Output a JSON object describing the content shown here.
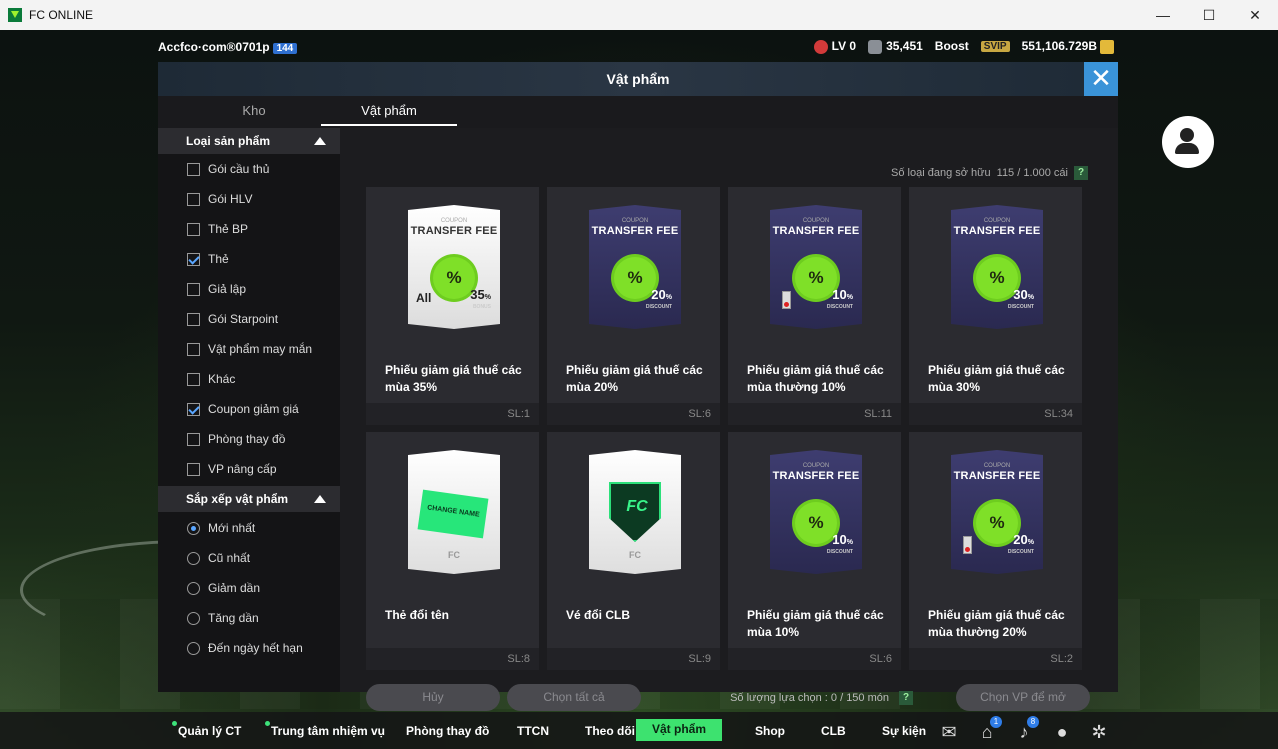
{
  "window": {
    "title": "FC ONLINE",
    "minimize": "—",
    "maximize": "☐",
    "close": "✕"
  },
  "topbar": {
    "account": "Accfco·com®0701p",
    "account_number": "144",
    "level": "LV 0",
    "trophies": "35,451",
    "boost": "Boost",
    "svip": "SVIP",
    "bp": "551,106.729B"
  },
  "dialog": {
    "title": "Vật phẩm",
    "close": "✕",
    "tabs": [
      {
        "label": "Kho"
      },
      {
        "label": "Vật phẩm"
      }
    ],
    "owned_label": "Số loại đang sở hữu",
    "owned_value": "115 / 1.000 cái",
    "help": "?",
    "product_section": "Loại sản phẩm",
    "product_types": [
      {
        "label": "Gói cầu thủ",
        "checked": false
      },
      {
        "label": "Gói HLV",
        "checked": false
      },
      {
        "label": "Thẻ BP",
        "checked": false
      },
      {
        "label": "Thẻ",
        "checked": true
      },
      {
        "label": "Giả lập",
        "checked": false
      },
      {
        "label": "Gói Starpoint",
        "checked": false
      },
      {
        "label": "Vật phẩm may mắn",
        "checked": false
      },
      {
        "label": "Khác",
        "checked": false
      },
      {
        "label": "Coupon giảm giá",
        "checked": true
      },
      {
        "label": "Phòng thay đồ",
        "checked": false
      },
      {
        "label": "VP nâng cấp",
        "checked": false
      }
    ],
    "sort_section": "Sắp xếp vật phẩm",
    "sort_options": [
      {
        "label": "Mới nhất",
        "selected": true
      },
      {
        "label": "Cũ nhất",
        "selected": false
      },
      {
        "label": "Giảm dần",
        "selected": false
      },
      {
        "label": "Tăng dần",
        "selected": false
      },
      {
        "label": "Đến ngày hết hạn",
        "selected": false
      }
    ],
    "items": [
      {
        "name": "Phiếu giảm giá thuế các mùa 35%",
        "qty": "SL:1",
        "style": "white",
        "coupon": "COUPON",
        "title": "TRANSFER FEE",
        "seal": "%",
        "pct": "35",
        "pct_label": "BONUS",
        "extra": "All"
      },
      {
        "name": "Phiếu giảm giá thuế các mùa 20%",
        "qty": "SL:6",
        "style": "dark",
        "coupon": "COUPON",
        "title": "TRANSFER FEE",
        "seal": "%",
        "pct": "20",
        "pct_label": "DISCOUNT"
      },
      {
        "name": "Phiếu giảm giá thuế các mùa thường 10%",
        "qty": "SL:11",
        "style": "dark",
        "coupon": "COUPON",
        "title": "TRANSFER FEE",
        "seal": "%",
        "pct": "10",
        "pct_label": "DISCOUNT",
        "badge": true
      },
      {
        "name": "Phiếu giảm giá thuế các mùa 30%",
        "qty": "SL:34",
        "style": "dark",
        "coupon": "COUPON",
        "title": "TRANSFER FEE",
        "seal": "%",
        "pct": "30",
        "pct_label": "DISCOUNT"
      },
      {
        "name": "Thẻ đổi tên",
        "qty": "SL:8",
        "style": "rename",
        "tag": "CHANGE NAME"
      },
      {
        "name": "Vé đổi CLB",
        "qty": "SL:9",
        "style": "club"
      },
      {
        "name": "Phiếu giảm giá thuế các mùa 10%",
        "qty": "SL:6",
        "style": "dark",
        "coupon": "COUPON",
        "title": "TRANSFER FEE",
        "seal": "%",
        "pct": "10",
        "pct_label": "DISCOUNT"
      },
      {
        "name": "Phiếu giảm giá thuế các mùa thường 20%",
        "qty": "SL:2",
        "style": "dark",
        "coupon": "COUPON",
        "title": "TRANSFER FEE",
        "seal": "%",
        "pct": "20",
        "pct_label": "DISCOUNT",
        "badge": true
      }
    ],
    "cancel": "Hủy",
    "select_all": "Chọn tất cả",
    "selected_count": "Số lượng lựa chọn : 0 / 150 món",
    "choose_items": "Chọn VP để mở"
  },
  "bottom_nav": [
    {
      "label": "Quản lý CT",
      "dot": true
    },
    {
      "label": "Trung tâm nhiệm vụ",
      "dot": true
    },
    {
      "label": "Phòng thay đồ"
    },
    {
      "label": "TTCN"
    },
    {
      "label": "Theo dõi"
    },
    {
      "label": "Vật phẩm",
      "active": true
    },
    {
      "label": "Shop"
    },
    {
      "label": "CLB"
    },
    {
      "label": "Sự kiện"
    }
  ],
  "nav_icons": [
    {
      "icon": "chat-icon",
      "count": ""
    },
    {
      "icon": "mail-icon",
      "count": "1"
    },
    {
      "icon": "bell-icon",
      "count": "8"
    },
    {
      "icon": "profile-icon",
      "count": ""
    },
    {
      "icon": "settings-icon",
      "count": ""
    }
  ]
}
